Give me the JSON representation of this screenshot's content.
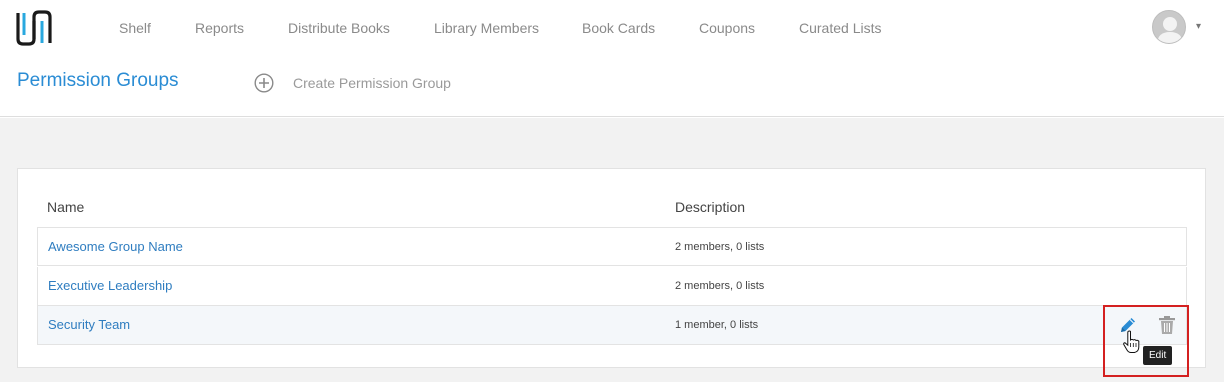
{
  "nav": {
    "items": [
      {
        "label": "Shelf"
      },
      {
        "label": "Reports"
      },
      {
        "label": "Distribute Books"
      },
      {
        "label": "Library Members"
      },
      {
        "label": "Book Cards"
      },
      {
        "label": "Coupons"
      },
      {
        "label": "Curated Lists"
      }
    ],
    "avatar_icon": "user-avatar-icon",
    "menu_caret": "▾"
  },
  "header": {
    "title": "Permission Groups",
    "create_label": "Create Permission Group"
  },
  "table": {
    "columns": [
      "Name",
      "Description"
    ],
    "rows": [
      {
        "name": "Awesome Group Name",
        "description": "2 members, 0 lists"
      },
      {
        "name": "Executive Leadership",
        "description": "2 members, 0 lists"
      },
      {
        "name": "Security Team",
        "description": "1 member, 0 lists"
      }
    ]
  },
  "tooltip": {
    "text": "Edit"
  },
  "colors": {
    "accent": "#2a8cd4",
    "link": "#2f7dc0",
    "highlight": "#d42020",
    "background": "#f2f2f2"
  }
}
